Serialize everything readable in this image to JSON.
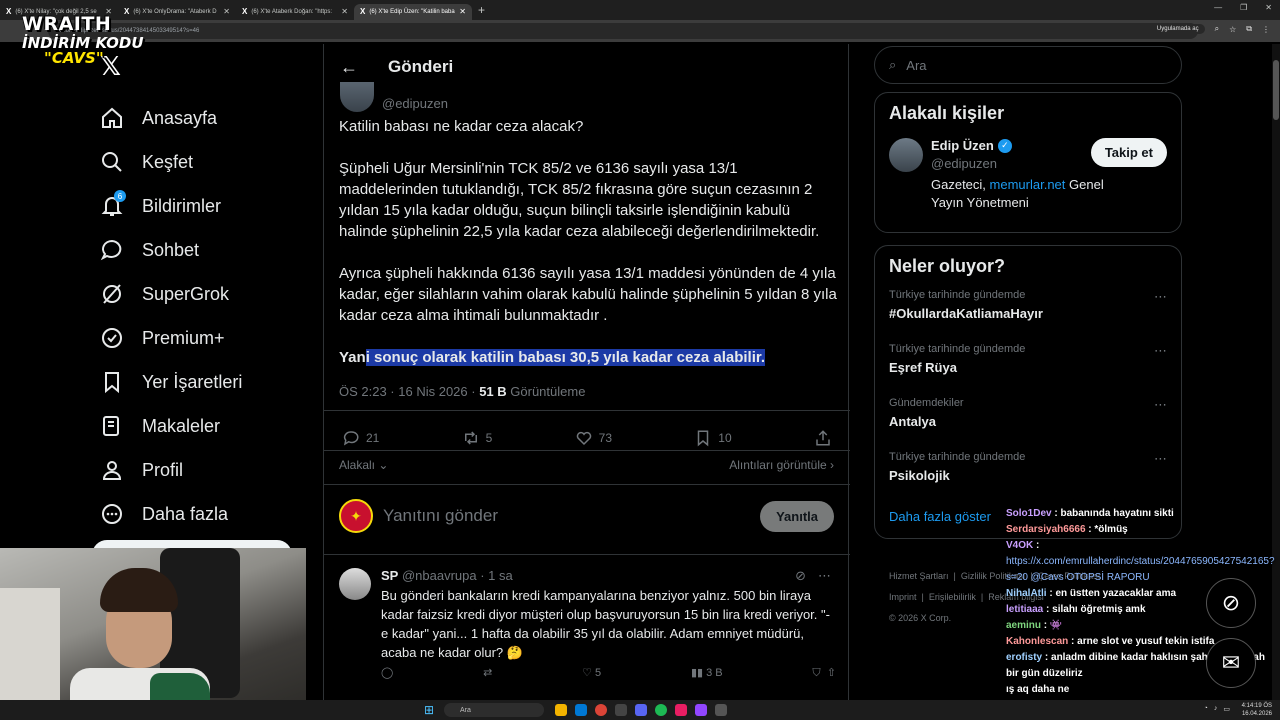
{
  "browser": {
    "tabs": [
      {
        "title": "(6) X'te Nilay: \"çok değil 2,5 se",
        "active": false
      },
      {
        "title": "(6) X'te OnlyDrama: \"Ataberk D",
        "active": false
      },
      {
        "title": "(6) X'te Ataberk Doğan: \"https:",
        "active": false
      },
      {
        "title": "(6) X'te Edip Üzen: \"Katilin baba",
        "active": true
      }
    ],
    "url": "x.com/edipuzen/status/2044738414503349514?s=46",
    "open_in_app": "Uygulamada aç"
  },
  "overlay": {
    "brand_line1": "WRAITH",
    "brand_line2": "İNDİRİM KODU",
    "brand_line3": "\"CAVS\""
  },
  "nav": {
    "home": "Anasayfa",
    "explore": "Keşfet",
    "notifications": "Bildirimler",
    "notifications_count": "6",
    "chat": "Sohbet",
    "grok": "SuperGrok",
    "premium": "Premium+",
    "bookmarks": "Yer İşaretleri",
    "articles": "Makaleler",
    "profile": "Profil",
    "more": "Daha fazla"
  },
  "post": {
    "header_title": "Gönderi",
    "handle": "@edipuzen",
    "p1": "Katilin babası ne kadar ceza alacak?",
    "p2": "Şüpheli Uğur Mersinli'nin TCK 85/2 ve 6136 sayılı yasa 13/1 maddelerinden tutuklandığı, TCK 85/2 fıkrasına göre suçun cezasının 2 yıldan 15 yıla kadar olduğu, suçun bilinçli taksirle işlendiğinin kabulü halinde şüphelinin 22,5 yıla kadar ceza alabileceği değerlendirilmektedir.",
    "p3": "Ayrıca şüpheli hakkında 6136 sayılı yasa 13/1 maddesi yönünden de 4 yıla kadar, eğer silahların vahim olarak kabulü halinde şüphelinin 5 yıldan 8 yıla kadar ceza alma ihtimali bulunmaktadır .",
    "p4_start": "Yan",
    "p4_highlight": "i sonuç olarak katilin babası 30,5 yıla kadar ceza alabilir.",
    "time": "ÖS 2:23 · 16 Nis 2026 · ",
    "views_count": "51 B",
    "views_label": "Görüntüleme",
    "replies": "21",
    "reposts": "5",
    "likes": "73",
    "bookmarks": "10",
    "relevant": "Alakalı",
    "quotes_link": "Alıntıları görüntüle",
    "reply_placeholder": "Yanıtını gönder",
    "reply_button": "Yanıtla"
  },
  "comment": {
    "name": "SP",
    "handle": "@nbaavrupa · 1 sa",
    "text": "Bu gönderi bankaların kredi kampanyalarına benziyor yalnız. 500 bin liraya kadar faizsiz kredi diyor müşteri olup başvuruyorsun 15 bin lira kredi veriyor. \"-e kadar\" yani... 1 hafta da olabilir 35 yıl da olabilir. Adam emniyet müdürü, acaba ne kadar olur? 🤔",
    "likes": "5",
    "views": "3 B"
  },
  "sidebar": {
    "search_placeholder": "Ara",
    "related_title": "Alakalı kişiler",
    "person_name": "Edip Üzen",
    "person_handle": "@edipuzen",
    "person_bio_1": "Gazeteci, ",
    "person_bio_link": "memurlar.net",
    "person_bio_2": " Genel Yayın Yönetmeni",
    "follow": "Takip et",
    "trends_title": "Neler oluyor?",
    "trends": [
      {
        "context": "Türkiye tarihinde gündemde",
        "name": "#OkullardaKatliamaHayır"
      },
      {
        "context": "Türkiye tarihinde gündemde",
        "name": "Eşref Rüya"
      },
      {
        "context": "Gündemdekiler",
        "name": "Antalya"
      },
      {
        "context": "Türkiye tarihinde gündemde",
        "name": "Psikolojik"
      }
    ],
    "show_more": "Daha fazla göster"
  },
  "footer": {
    "terms": "Hizmet Şartları",
    "privacy": "Gizlilik Politikası",
    "cookie": "Çerez Politikası",
    "imprint": "Imprint",
    "accessibility": "Erişilebilirlik",
    "ads": "Reklam bilgisi",
    "copyright": "© 2026 X Corp."
  },
  "chat": [
    {
      "user": "Solo1Dev",
      "msg": "babanında hayatını sikti"
    },
    {
      "user": "Serdarsiyah6666",
      "msg": "*ölmüş"
    },
    {
      "user": "V4OK",
      "msg": ""
    },
    {
      "user": "",
      "msg": "https://x.com/emrullaherdinc/status/2044765905427542165?s=20 @Cavs OTOPSİ RAPORU"
    },
    {
      "user": "NihalAtli",
      "msg": "en üstten yazacaklar ama"
    },
    {
      "user": "letitiaaa",
      "msg": "silahı öğretmiş amk"
    },
    {
      "user": "aeminu",
      "msg": "👾"
    },
    {
      "user": "Kahonlescan",
      "msg": "arne slot ve yusuf tekin istifa"
    },
    {
      "user": "erofisty",
      "msg": "anladm dibine kadar haklısın şahsen inşallah bir gün düzeliriz"
    },
    {
      "user": "",
      "msg": "ış aq daha ne"
    }
  ],
  "taskbar": {
    "search": "Ara",
    "time": "4:14:19 ÖS",
    "date": "16.04.2026"
  }
}
